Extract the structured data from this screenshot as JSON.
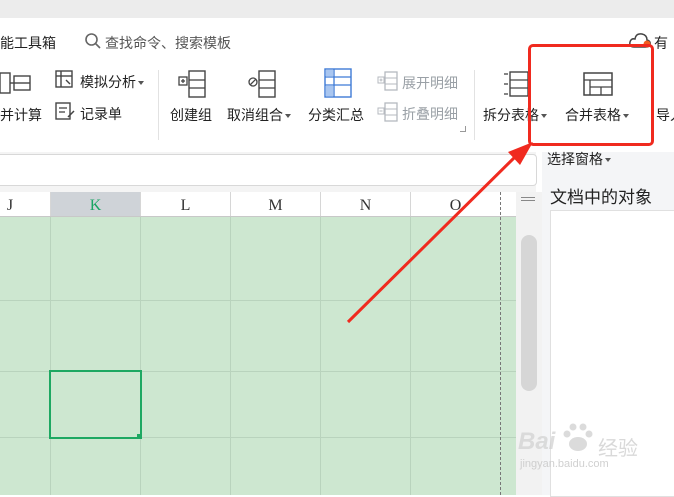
{
  "menu": {
    "toolbox": "能工具箱",
    "search_placeholder": "查找命令、搜索模板",
    "user": "有"
  },
  "ribbon": {
    "merge_calc": "并计算",
    "what_if": "模拟分析",
    "record_form": "记录单",
    "create_group": "创建组",
    "ungroup": "取消组合",
    "subtotal": "分类汇总",
    "expand_detail": "展开明细",
    "collapse_detail": "折叠明细",
    "split_table": "拆分表格",
    "merge_table": "合并表格",
    "import": "导入"
  },
  "pane": {
    "select_pane": "选择窗格",
    "objects_title": "文档中的对象"
  },
  "sheet": {
    "columns": [
      "J",
      "K",
      "L",
      "M",
      "N",
      "O"
    ],
    "selected_column": "K"
  },
  "watermark": {
    "brand": "Bai",
    "brand2": "经验",
    "url": "jingyan.baidu.com"
  },
  "colors": {
    "accent_green": "#1ea862",
    "grid_fill": "#cde7d0",
    "highlight_red": "#f02a1f"
  }
}
